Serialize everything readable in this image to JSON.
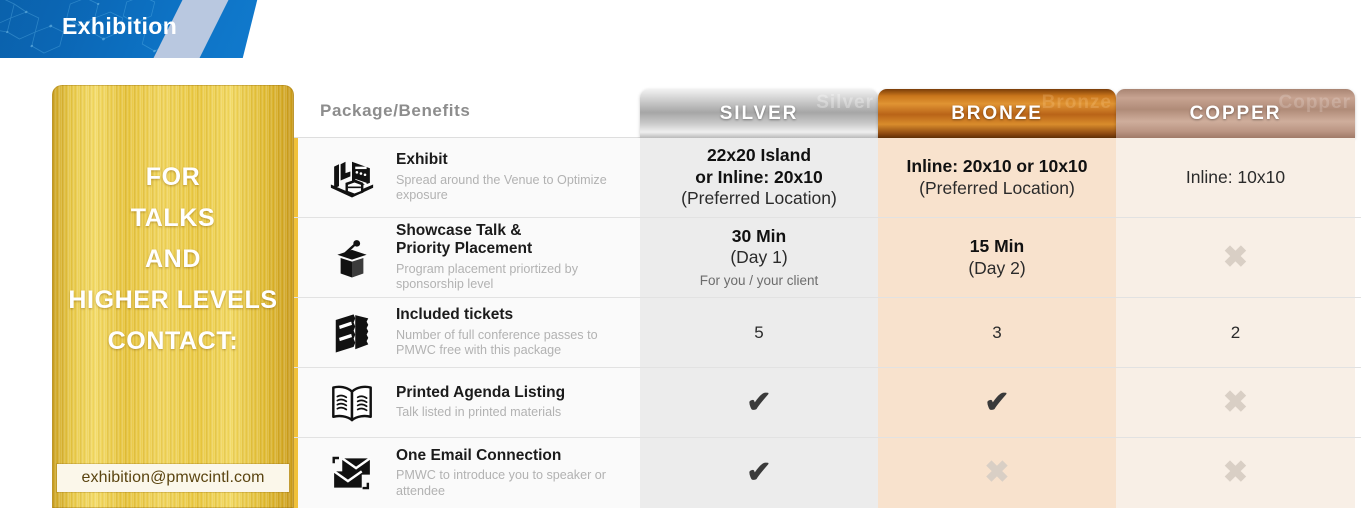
{
  "banner": {
    "title": "Exhibition",
    "accent_color": "#0d6ebc"
  },
  "sidebar": {
    "lines": [
      "FOR",
      "TALKS",
      "AND",
      "HIGHER LEVELS",
      "CONTACT:"
    ],
    "email": "exhibition@pmwcintl.com",
    "accent_color": "#e8c842"
  },
  "table": {
    "benefits_header": "Package/Benefits",
    "columns": [
      {
        "label": "SILVER",
        "ghost": "Silver",
        "color": "#a6a6a6",
        "bg": "#ececec"
      },
      {
        "label": "BRONZE",
        "ghost": "Bronze",
        "color": "#b96418",
        "bg": "#f8e2cd"
      },
      {
        "label": "COPPER",
        "ghost": "Copper",
        "color": "#b08b78",
        "bg": "#f8efe6"
      }
    ],
    "rows": [
      {
        "icon": "exhibition-booth-icon",
        "title": "Exhibit",
        "subtitle": "Spread around the Venue to Optimize exposure",
        "silver": {
          "type": "text",
          "strong": "22x20 Island\nor Inline: 20x10",
          "normal": "(Preferred Location)"
        },
        "bronze": {
          "type": "text",
          "strong": "Inline: 20x10 or 10x10",
          "normal": "(Preferred Location)"
        },
        "copper": {
          "type": "text",
          "strong": "",
          "normal": "Inline: 10x10"
        }
      },
      {
        "icon": "podium-microphone-icon",
        "title": "Showcase Talk &\nPriority Placement",
        "subtitle": "Program placement priortized by sponsorship level",
        "silver": {
          "type": "text",
          "strong": "30 Min",
          "normal": "(Day 1)",
          "sub": "For you / your client"
        },
        "bronze": {
          "type": "text",
          "strong": "15 Min",
          "normal": "(Day 2)"
        },
        "copper": {
          "type": "cross"
        }
      },
      {
        "icon": "tickets-icon",
        "title": "Included tickets",
        "subtitle": "Number of full conference passes to PMWC free with this package",
        "silver": {
          "type": "number",
          "value": "5"
        },
        "bronze": {
          "type": "number",
          "value": "3"
        },
        "copper": {
          "type": "number",
          "value": "2"
        }
      },
      {
        "icon": "open-book-icon",
        "title": "Printed Agenda Listing",
        "subtitle": "Talk listed in printed materials",
        "silver": {
          "type": "check"
        },
        "bronze": {
          "type": "check"
        },
        "copper": {
          "type": "cross"
        }
      },
      {
        "icon": "envelopes-icon",
        "title": "One Email Connection",
        "subtitle": "PMWC to introduce you to speaker or attendee",
        "silver": {
          "type": "check"
        },
        "bronze": {
          "type": "cross"
        },
        "copper": {
          "type": "cross"
        }
      }
    ],
    "check_glyph": "✔",
    "cross_glyph": "✖"
  }
}
